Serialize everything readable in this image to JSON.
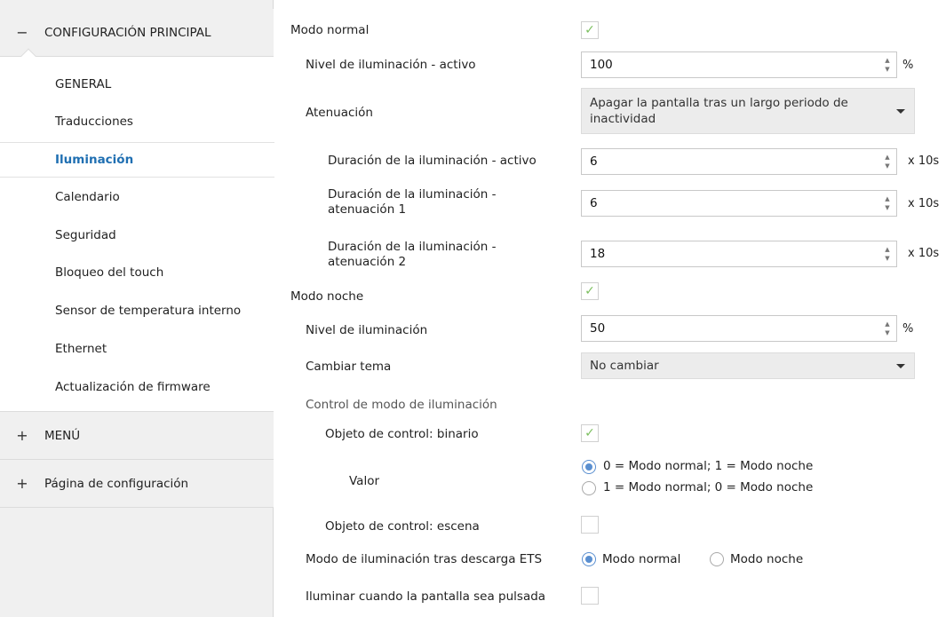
{
  "sidebar": {
    "sections": [
      {
        "sign": "−",
        "label": "CONFIGURACIÓN PRINCIPAL"
      },
      {
        "sign": "+",
        "label": "MENÚ"
      },
      {
        "sign": "+",
        "label": "Página de configuración"
      }
    ],
    "items": [
      "GENERAL",
      "Traducciones",
      "Iluminación",
      "Calendario",
      "Seguridad",
      "Bloqueo del touch",
      "Sensor de temperatura interno",
      "Ethernet",
      "Actualización de firmware"
    ]
  },
  "main": {
    "modo_normal": "Modo normal",
    "nivel_activo": "Nivel de iluminación - activo",
    "nivel_activo_value": "100",
    "unit_percent": "%",
    "atenuacion": "Atenuación",
    "atenuacion_value": "Apagar la pantalla tras un largo periodo de inactividad",
    "dur_activo": "Duración de la iluminación - activo",
    "dur_activo_value": "6",
    "dur_aten1": "Duración de la iluminación - atenuación 1",
    "dur_aten1_value": "6",
    "dur_aten2": "Duración de la iluminación - atenuación 2",
    "dur_aten2_value": "18",
    "unit_x10s": "x 10s",
    "modo_noche": "Modo noche",
    "nivel": "Nivel de iluminación",
    "nivel_value": "50",
    "cambiar_tema": "Cambiar tema",
    "cambiar_tema_value": "No cambiar",
    "control_modo": "Control de modo de iluminación",
    "obj_binario": "Objeto de control: binario",
    "valor": "Valor",
    "valor_opt1": "0 = Modo normal; 1 = Modo noche",
    "valor_opt2": "1 = Modo normal; 0 = Modo noche",
    "obj_escena": "Objeto de control: escena",
    "modo_tras_descarga": "Modo de iluminación tras descarga ETS",
    "modo_opt1": "Modo normal",
    "modo_opt2": "Modo noche",
    "iluminar_pulsada": "Iluminar cuando la pantalla sea pulsada",
    "check_glyph": "✓"
  },
  "colors": {
    "accent": "#1f6fb2",
    "check": "#7cbf5f",
    "radio": "#5a8fd0"
  }
}
